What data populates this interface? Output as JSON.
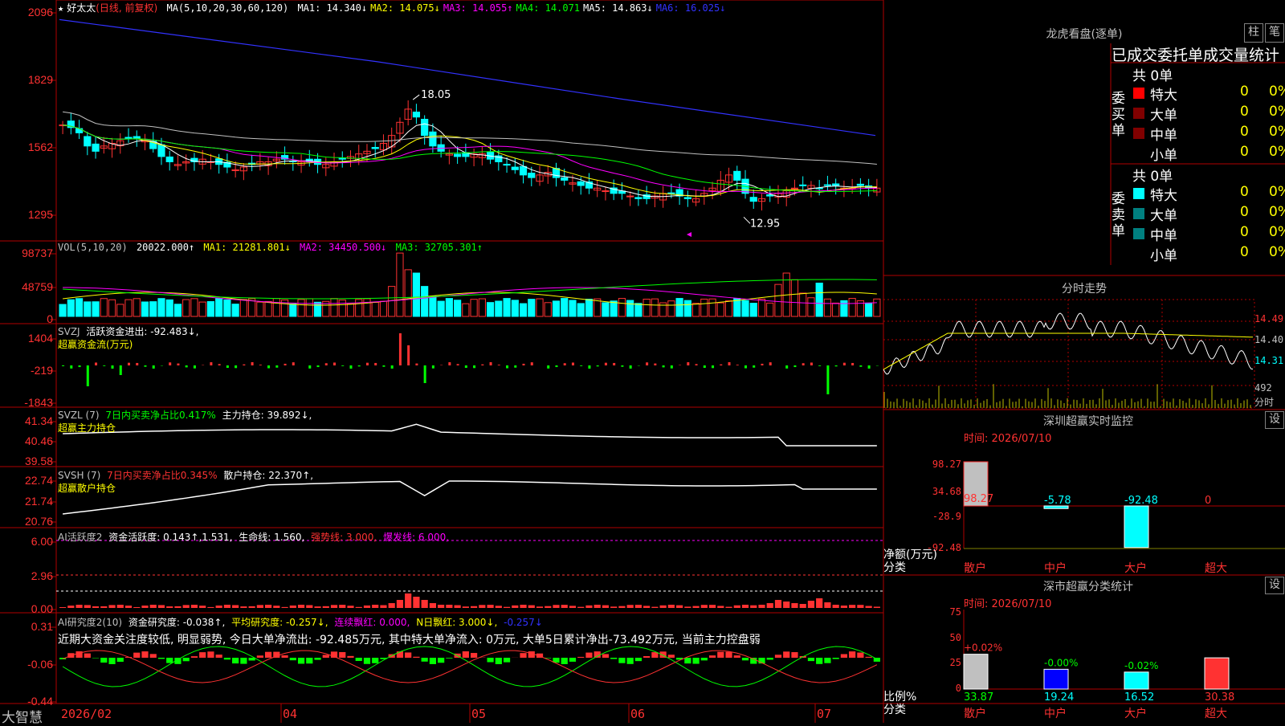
{
  "stock_name": "好太太",
  "period_label": "(日线, 前复权)",
  "ma_header": {
    "label": "MA(5,10,20,30,60,120)",
    "items": [
      {
        "name": "MA1",
        "value": "14.340↓",
        "color": "#ffffff"
      },
      {
        "name": "MA2",
        "value": "14.075↓",
        "color": "#ffff00"
      },
      {
        "name": "MA3",
        "value": "14.055↑",
        "color": "#ff00ff"
      },
      {
        "name": "MA4",
        "value": "14.071",
        "color": "#00ff00"
      },
      {
        "name": "MA5",
        "value": "14.863↓",
        "color": "#ffffff"
      },
      {
        "name": "MA6",
        "value": "16.025↓",
        "color": "#3232ff"
      }
    ]
  },
  "price_axis": [
    "2096",
    "1829",
    "1562",
    "1295"
  ],
  "high_marker": "18.05",
  "low_marker": "12.95",
  "vol_header": {
    "label": "VOL(5,10,20)",
    "value": "20022.000↑",
    "ma1": "MA1: 21281.801↓",
    "ma2": "MA2: 34450.500↓",
    "ma3": "MA3: 32705.301↑"
  },
  "vol_axis": [
    "98737",
    "48759",
    "0"
  ],
  "svzj_header": {
    "label": "SVZJ",
    "text": "活跃资金进出: -92.483↓,",
    "sub": "超赢资金流(万元)"
  },
  "svzj_axis": [
    "1404",
    "-219",
    "-1843"
  ],
  "svzl_header": {
    "label": "SVZL (7)",
    "text1": "7日内买卖净占比0.417%",
    "text2": "主力持仓: 39.892↓,",
    "sub": "超赢主力持仓"
  },
  "svzl_axis": [
    "41.34",
    "40.46",
    "39.58"
  ],
  "svsh_header": {
    "label": "SVSH (7)",
    "text1": "7日内买卖净占比0.345%",
    "text2": "散户持仓: 22.370↑,",
    "sub": "超赢散户持仓"
  },
  "svsh_axis": [
    "22.74",
    "21.74",
    "20.76"
  ],
  "ai_active_header": {
    "label": "AI活跃度2",
    "t1": "资金活跃度: 0.143↑,1.531,",
    "t2": "生命线: 1.560,",
    "t3": "强势线: 3.000,",
    "t4": "爆发线: 6.000,"
  },
  "ai_active_axis": [
    "6.00",
    "2.96",
    "0.00"
  ],
  "ai_research_header": {
    "label": "AI研究度2(10)",
    "t1": "资金研究度: -0.038↑,",
    "t2": "平均研究度: -0.257↓,",
    "t3": "连续飘红: 0.000,",
    "t4": "N日飘红: 3.000↓,",
    "t5": "-0.257↓"
  },
  "ai_research_note": "近期大资金关注度较低, 明显弱势, 今日大单净流出: -92.485万元, 其中特大单净流入: 0万元, 大单5日累计净出-73.492万元, 当前主力控盘弱",
  "ai_research_axis": [
    "0.31",
    "-0.06",
    "-0.44"
  ],
  "bottom_brand": "大智慧",
  "date_labels": [
    "2026/02",
    "04",
    "05",
    "06",
    "07"
  ],
  "right": {
    "lh_title": "龙虎看盘(逐单)",
    "btn_zhu": "柱",
    "btn_bi": "笔",
    "stats_title": "已成交委托单成交量统计",
    "buy_label": "委买单",
    "sell_label": "委卖单",
    "buy_total": "共 0单",
    "sell_total": "共 0单",
    "buy_rows": [
      {
        "label": "特大",
        "count": "0",
        "pct": "0%",
        "color": "#ff0000"
      },
      {
        "label": "大单",
        "count": "0",
        "pct": "0%",
        "color": "#800000"
      },
      {
        "label": "中单",
        "count": "0",
        "pct": "0%",
        "color": "#800000"
      },
      {
        "label": "小单",
        "count": "0",
        "pct": "0%",
        "color": ""
      }
    ],
    "sell_rows": [
      {
        "label": "特大",
        "count": "0",
        "pct": "0%",
        "color": "#00ffff"
      },
      {
        "label": "大单",
        "count": "0",
        "pct": "0%",
        "color": "#008080"
      },
      {
        "label": "中单",
        "count": "0",
        "pct": "0%",
        "color": "#008080"
      },
      {
        "label": "小单",
        "count": "0",
        "pct": "0%",
        "color": ""
      }
    ],
    "intraday_title": "分时走势",
    "intraday_axis": [
      "14.49",
      "14.40",
      "14.31"
    ],
    "intraday_vol_val": "492",
    "intraday_vol_unit": "分时",
    "monitor_title": "深圳超赢实时监控",
    "monitor_btn": "设",
    "monitor_time": "时间: 2026/07/10",
    "monitor_axis": [
      "98.27",
      "34.68",
      "-28.9",
      "-92.48"
    ],
    "monitor_values": [
      {
        "cat": "散户",
        "value": 98.27,
        "label": "98.27"
      },
      {
        "cat": "中户",
        "value": -5.78,
        "label": "-5.78"
      },
      {
        "cat": "大户",
        "value": -92.48,
        "label": "-92.48"
      },
      {
        "cat": "超大",
        "value": 0,
        "label": "0"
      }
    ],
    "monitor_ylabel": "净额(万元)",
    "monitor_xlabel": "分类",
    "class_title": "深市超赢分类统计",
    "class_btn": "设",
    "class_time": "时间: 2026/07/10",
    "class_axis": [
      "75",
      "50",
      "25",
      "0"
    ],
    "class_values": [
      {
        "cat": "散户",
        "value": 33.87,
        "label": "33.87",
        "delta": "+0.02%"
      },
      {
        "cat": "中户",
        "value": 19.24,
        "label": "19.24",
        "delta": "-0.00%"
      },
      {
        "cat": "大户",
        "value": 16.52,
        "label": "16.52",
        "delta": "-0.02%"
      },
      {
        "cat": "超大",
        "value": 30.38,
        "label": "30.38",
        "delta": ""
      }
    ],
    "class_ylabel": "比例%",
    "class_xlabel": "分类"
  },
  "colors": {
    "up": "#ff3232",
    "down": "#00ffff",
    "grid": "#b00000",
    "axis": "#ff3232"
  }
}
